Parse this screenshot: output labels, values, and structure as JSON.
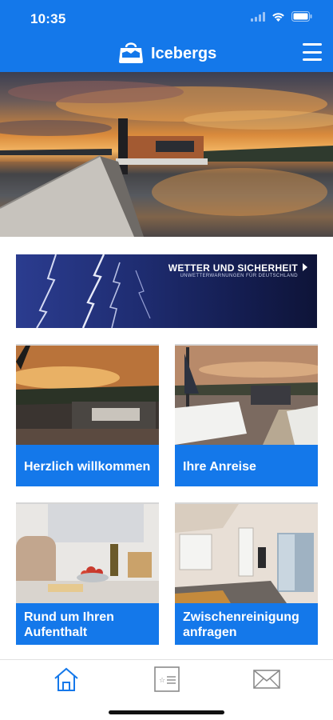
{
  "status_bar": {
    "time": "10:35",
    "icons": [
      "signal-icon",
      "wifi-icon",
      "battery-icon"
    ]
  },
  "app_bar": {
    "title": "Icebergs",
    "logo_icon": "bag-logo-icon",
    "menu_icon": "hamburger-menu-icon"
  },
  "colors": {
    "primary": "#1478ea",
    "tile_label_bg": "#1478ea",
    "nav_active": "#1478ea",
    "nav_inactive": "#8a8a8a"
  },
  "weather_banner": {
    "title": "WETTER UND SICHERHEIT",
    "subtitle": "UNWETTERWARNUNGEN FÜR DEUTSCHLAND",
    "arrow_icon": "chevron-right-icon"
  },
  "tiles": [
    {
      "label": "Herzlich willkommen"
    },
    {
      "label": "Ihre Anreise"
    },
    {
      "label": "Rund um Ihren Aufenthalt"
    },
    {
      "label": "Zwischenreinigung anfragen"
    }
  ],
  "bottom_nav": [
    {
      "icon": "home-icon",
      "active": true
    },
    {
      "icon": "contact-card-icon",
      "active": false
    },
    {
      "icon": "mail-icon",
      "active": false
    }
  ]
}
